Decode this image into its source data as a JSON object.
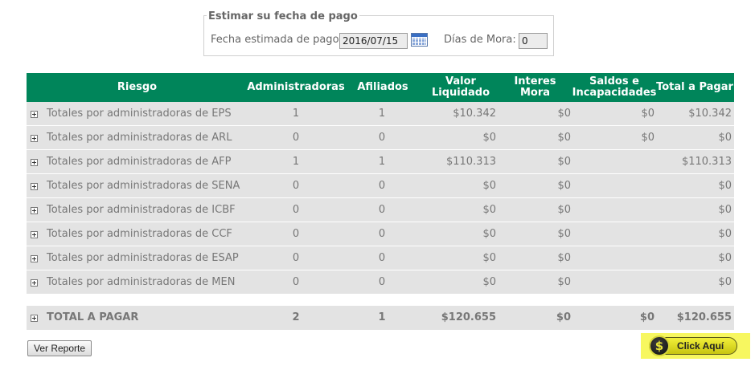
{
  "estimator": {
    "legend": "Estimar su fecha de pago",
    "date_label": "Fecha estimada de pago",
    "date_value": "2016/07/15",
    "mora_label": "Días de Mora:",
    "mora_value": "0"
  },
  "table": {
    "headers": {
      "riesgo": "Riesgo",
      "administradoras": "Administradoras",
      "afiliados": "Afiliados",
      "valor_liquidado": "Valor Liquidado",
      "interes_mora": "Interes Mora",
      "saldos": "Saldos e Incapacidades",
      "total": "Total a Pagar"
    },
    "rows": [
      {
        "riesgo": "Totales por administradoras de EPS",
        "administradoras": "1",
        "afiliados": "1",
        "valor": "$10.342",
        "interes": "$0",
        "saldos": "$0",
        "total": "$10.342"
      },
      {
        "riesgo": "Totales por administradoras de ARL",
        "administradoras": "0",
        "afiliados": "0",
        "valor": "$0",
        "interes": "$0",
        "saldos": "$0",
        "total": "$0"
      },
      {
        "riesgo": "Totales por administradoras de AFP",
        "administradoras": "1",
        "afiliados": "1",
        "valor": "$110.313",
        "interes": "$0",
        "saldos": "",
        "total": "$110.313"
      },
      {
        "riesgo": "Totales por administradoras de SENA",
        "administradoras": "0",
        "afiliados": "0",
        "valor": "$0",
        "interes": "$0",
        "saldos": "",
        "total": "$0"
      },
      {
        "riesgo": "Totales por administradoras de ICBF",
        "administradoras": "0",
        "afiliados": "0",
        "valor": "$0",
        "interes": "$0",
        "saldos": "",
        "total": "$0"
      },
      {
        "riesgo": "Totales por administradoras de CCF",
        "administradoras": "0",
        "afiliados": "0",
        "valor": "$0",
        "interes": "$0",
        "saldos": "",
        "total": "$0"
      },
      {
        "riesgo": "Totales por administradoras de ESAP",
        "administradoras": "0",
        "afiliados": "0",
        "valor": "$0",
        "interes": "$0",
        "saldos": "",
        "total": "$0"
      },
      {
        "riesgo": "Totales por administradoras de MEN",
        "administradoras": "0",
        "afiliados": "0",
        "valor": "$0",
        "interes": "$0",
        "saldos": "",
        "total": "$0"
      }
    ],
    "total_row": {
      "label": "TOTAL A PAGAR",
      "administradoras": "2",
      "afiliados": "1",
      "valor": "$120.655",
      "interes": "$0",
      "saldos": "$0",
      "total": "$120.655"
    }
  },
  "actions": {
    "report_button": "Ver Reporte",
    "click_button": "Click Aquí",
    "coin_symbol": "$"
  },
  "colors": {
    "header_bg": "#00855a",
    "row_bg": "#e3e3e3",
    "highlight": "#f7f760"
  },
  "icons": {
    "calendar": "calendar-icon",
    "expand": "expand-plus-icon",
    "coin": "dollar-coin-icon"
  }
}
